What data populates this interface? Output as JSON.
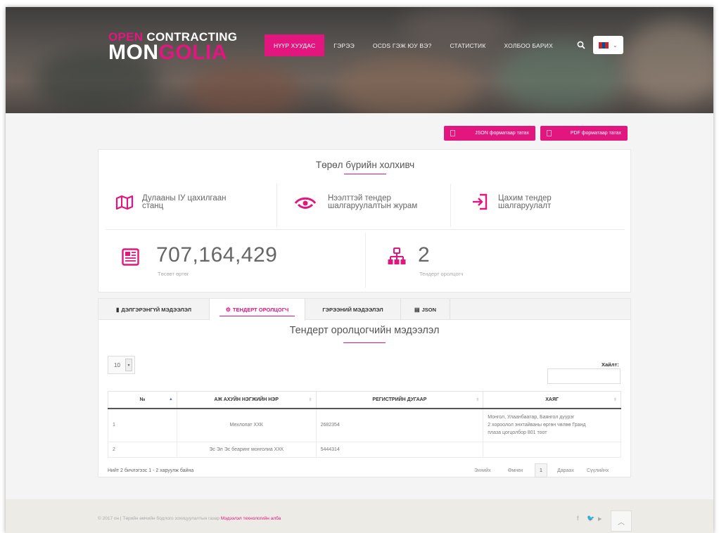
{
  "logo": {
    "line1_a": "OPEN",
    "line1_b": "CONTRACTING",
    "line2_a": "MON",
    "line2_b": "GOLIA"
  },
  "nav": {
    "items": [
      "НҮҮР ХУУДАС",
      "ГЭРЭЭ",
      "OCDS ГЭЖ ЮУ ВЭ?",
      "СТАТИСТИК",
      "ХОЛБОО БАРИХ"
    ],
    "active_index": 0
  },
  "downloads": {
    "json_label": "JSON форматаар татах",
    "pdf_label": "PDF форматаар татах"
  },
  "summary": {
    "title": "Төрөл бүрийн холхивч",
    "features": [
      {
        "icon": "map-icon",
        "text_line1": "Дулааны IУ цахилгаан",
        "text_line2": "станц"
      },
      {
        "icon": "eye-icon",
        "text_line1": "Нээлттэй тендер",
        "text_line2": "шалгаруулалтын журам"
      },
      {
        "icon": "sign-in-icon",
        "text_line1": "Цахим тендер",
        "text_line2": "шалгаруулалт"
      }
    ],
    "budget": {
      "value": "707,164,429",
      "label": "Төсөвт өртөг"
    },
    "bidders": {
      "value": "2",
      "label": "Тендерт оролцогч"
    }
  },
  "tabs": [
    {
      "icon": "book-icon",
      "label": "ДЭЛГЭРЭНГҮЙ МЭДЭЭЛЭЛ"
    },
    {
      "icon": "cogs-icon",
      "label": "ТЕНДЕРТ ОРОЛЦОГЧ"
    },
    {
      "icon": "",
      "label": "ГЭРЭЭНИЙ МЭДЭЭЛЭЛ"
    },
    {
      "icon": "file-icon",
      "label": "JSON"
    }
  ],
  "active_tab": 1,
  "bidders_section": {
    "title": "Тендерт оролцогчийн мэдээлэл",
    "page_size": "10",
    "search_label": "Хайлт:",
    "search_value": "",
    "columns": [
      "№",
      "АЖ АХУЙН НЭГЖИЙН НЭР",
      "РЕГИСТРИЙН ДУГААР",
      "ХАЯГ"
    ],
    "rows": [
      {
        "no": "1",
        "name": "Мехлопат ХХК",
        "reg": "2682354",
        "address_l1": "Монгол, Улаанбаатар, Баянгол дүүрэг",
        "address_l2": "2 хороолол энхтайваны өргөн чөлөө Гранд",
        "address_l3": "плаза цогцолбор 801 тоот"
      },
      {
        "no": "2",
        "name": "Эс Эл Эс беаринг монголиа ХХК",
        "reg": "5444314",
        "address_l1": "",
        "address_l2": "",
        "address_l3": ""
      }
    ],
    "info": "Нийт 2 бичлэгээс 1 - 2 харуулж байна",
    "pager": {
      "first": "Эхнийх",
      "prev": "Өмнөх",
      "current": "1",
      "next": "Дараах",
      "last": "Сүүлийнх"
    }
  },
  "footer": {
    "text": "© 2017 он | Төрийн өмчийн бодлого зохицуулалтын газар",
    "link": "Мэдээлэл технологийн алба"
  },
  "colors": {
    "accent": "#e3157e",
    "header_bg": "#4b4542",
    "footer_bg": "#ecebe6"
  }
}
